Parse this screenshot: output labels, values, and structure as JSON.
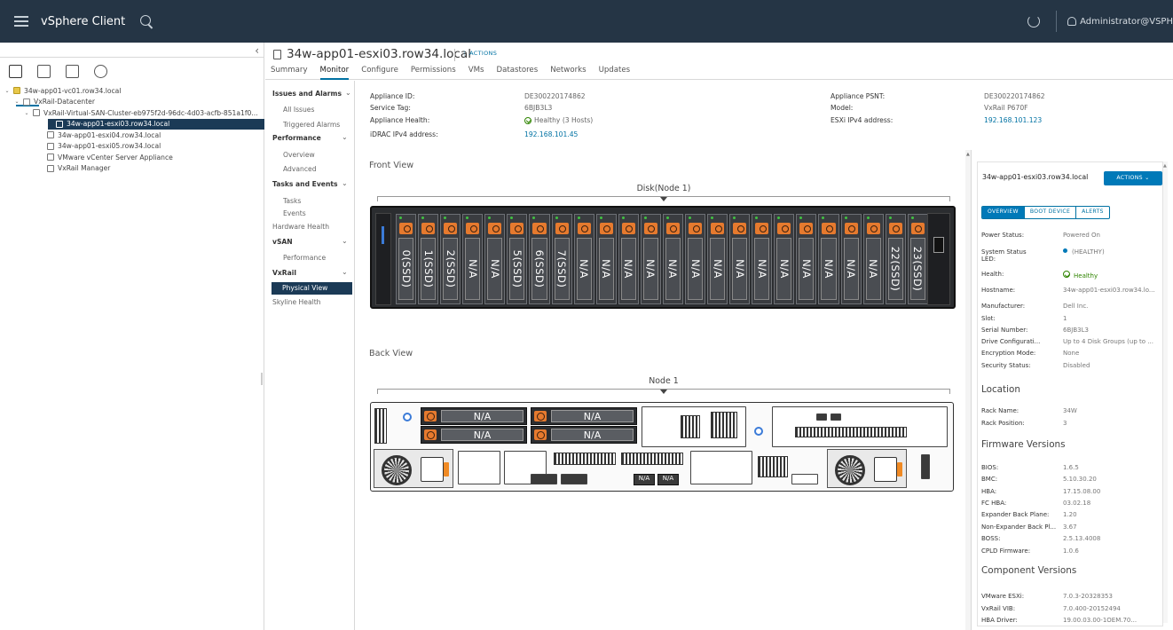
{
  "topbar": {
    "brand": "vSphere Client",
    "user": "Administrator@VSPH"
  },
  "tree": [
    {
      "label": "34w-app01-vc01.row34.local",
      "depth": 0,
      "caret": "v",
      "icon": "vcenter"
    },
    {
      "label": "VxRail-Datacenter",
      "depth": 1,
      "caret": "v",
      "icon": "datacenter"
    },
    {
      "label": "VxRail-Virtual-SAN-Cluster-eb975f2d-96dc-4d03-acfb-851a1f0...",
      "depth": 2,
      "caret": "v",
      "icon": "cluster"
    },
    {
      "label": "34w-app01-esxi03.row34.local",
      "depth": 3,
      "caret": "",
      "icon": "host",
      "selected": true
    },
    {
      "label": "34w-app01-esxi04.row34.local",
      "depth": 3,
      "caret": "",
      "icon": "host"
    },
    {
      "label": "34w-app01-esxi05.row34.local",
      "depth": 3,
      "caret": "",
      "icon": "host"
    },
    {
      "label": "VMware vCenter Server Appliance",
      "depth": 3,
      "caret": "",
      "icon": "vm"
    },
    {
      "label": "VxRail Manager",
      "depth": 3,
      "caret": "",
      "icon": "vm"
    }
  ],
  "header": {
    "title": "34w-app01-esxi03.row34.local",
    "actions": "ACTIONS",
    "tabs": [
      "Summary",
      "Monitor",
      "Configure",
      "Permissions",
      "VMs",
      "Datastores",
      "Networks",
      "Updates"
    ],
    "active_tab": "Monitor"
  },
  "monitor_nav": {
    "issues": "Issues and Alarms",
    "all_issues": "All Issues",
    "triggered_alarms": "Triggered Alarms",
    "performance": "Performance",
    "overview": "Overview",
    "advanced": "Advanced",
    "tasks_events": "Tasks and Events",
    "tasks": "Tasks",
    "events": "Events",
    "hardware_health": "Hardware Health",
    "vsan": "vSAN",
    "vsan_performance": "Performance",
    "vxrail": "VxRail",
    "physical_view": "Physical View",
    "skyline": "Skyline Health"
  },
  "appliance": {
    "id_label": "Appliance ID:",
    "id": "DE300220174862",
    "tag_label": "Service Tag:",
    "tag": "6BJB3L3",
    "health_label": "Appliance Health:",
    "health": "Healthy (3 Hosts)",
    "idrac_label": "iDRAC IPv4 address:",
    "idrac": "192.168.101.45",
    "psnt_label": "Appliance PSNT:",
    "psnt": "DE300220174862",
    "model_label": "Model:",
    "model": "VxRail P670F",
    "esxi_label": "ESXi IPv4 address:",
    "esxi": "192.168.101.123"
  },
  "front_view": {
    "label": "Front View",
    "bracket": "Disk(Node 1)",
    "disks": [
      "0(SSD)",
      "1(SSD)",
      "2(SSD)",
      "N/A",
      "N/A",
      "5(SSD)",
      "6(SSD)",
      "7(SSD)",
      "N/A",
      "N/A",
      "N/A",
      "N/A",
      "N/A",
      "N/A",
      "N/A",
      "N/A",
      "N/A",
      "N/A",
      "N/A",
      "N/A",
      "N/A",
      "N/A",
      "22(SSD)",
      "23(SSD)"
    ]
  },
  "back_view": {
    "label": "Back View",
    "bracket": "Node 1",
    "bays": [
      "N/A",
      "N/A",
      "N/A",
      "N/A"
    ],
    "mini_bays": [
      "N/A",
      "N/A"
    ]
  },
  "details": {
    "title": "34w-app01-esxi03.row34.local",
    "actions": "ACTIONS",
    "tabs": [
      "OVERVIEW",
      "BOOT DEVICE",
      "ALERTS"
    ],
    "active_tab": "OVERVIEW",
    "overview": [
      {
        "k": "Power Status:",
        "v": "Powered On"
      },
      {
        "k": "System Status LED:",
        "v": "(HEALTHY)"
      },
      {
        "k": "Health:",
        "v": "Healthy"
      },
      {
        "k": "Hostname:",
        "v": "34w-app01-esxi03.row34.lo..."
      },
      {
        "k": "Manufacturer:",
        "v": "Dell Inc."
      },
      {
        "k": "Slot:",
        "v": "1"
      },
      {
        "k": "Serial Number:",
        "v": "6BJB3L3"
      },
      {
        "k": "Drive Configurati...",
        "v": "Up to 4 Disk Groups (up to ..."
      },
      {
        "k": "Encryption Mode:",
        "v": "None"
      },
      {
        "k": "Security Status:",
        "v": "Disabled"
      }
    ],
    "location_title": "Location",
    "location": [
      {
        "k": "Rack Name:",
        "v": "34W"
      },
      {
        "k": "Rack Position:",
        "v": "3"
      }
    ],
    "firmware_title": "Firmware Versions",
    "firmware": [
      {
        "k": "BIOS:",
        "v": "1.6.5"
      },
      {
        "k": "BMC:",
        "v": "5.10.30.20"
      },
      {
        "k": "HBA:",
        "v": "17.15.08.00"
      },
      {
        "k": "FC HBA:",
        "v": "03.02.18"
      },
      {
        "k": "Expander Back Plane:",
        "v": "1.20"
      },
      {
        "k": "Non-Expander Back Pl...",
        "v": "3.67"
      },
      {
        "k": "BOSS:",
        "v": "2.5.13.4008"
      },
      {
        "k": "CPLD Firmware:",
        "v": "1.0.6"
      }
    ],
    "component_title": "Component Versions",
    "components": [
      {
        "k": "VMware ESXi:",
        "v": "7.0.3-20328353"
      },
      {
        "k": "VxRail VIB:",
        "v": "7.0.400-20152494"
      },
      {
        "k": "HBA Driver:",
        "v": "19.00.03.00-1OEM.70..."
      }
    ]
  }
}
